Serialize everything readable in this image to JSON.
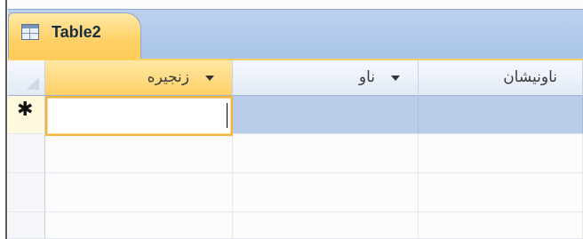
{
  "tab": {
    "title": "Table2",
    "icon": "table-icon"
  },
  "columns": [
    {
      "label": "زنجیره",
      "selected": true
    },
    {
      "label": "ناو",
      "selected": false
    },
    {
      "label": "ناونیشان",
      "selected": false
    }
  ],
  "new_row_marker": "✱",
  "colors": {
    "tab_accent": "#ffd166",
    "tabbar": "#bcd2ee",
    "new_row": "#b9cde8",
    "focus_border": "#f6b341"
  }
}
